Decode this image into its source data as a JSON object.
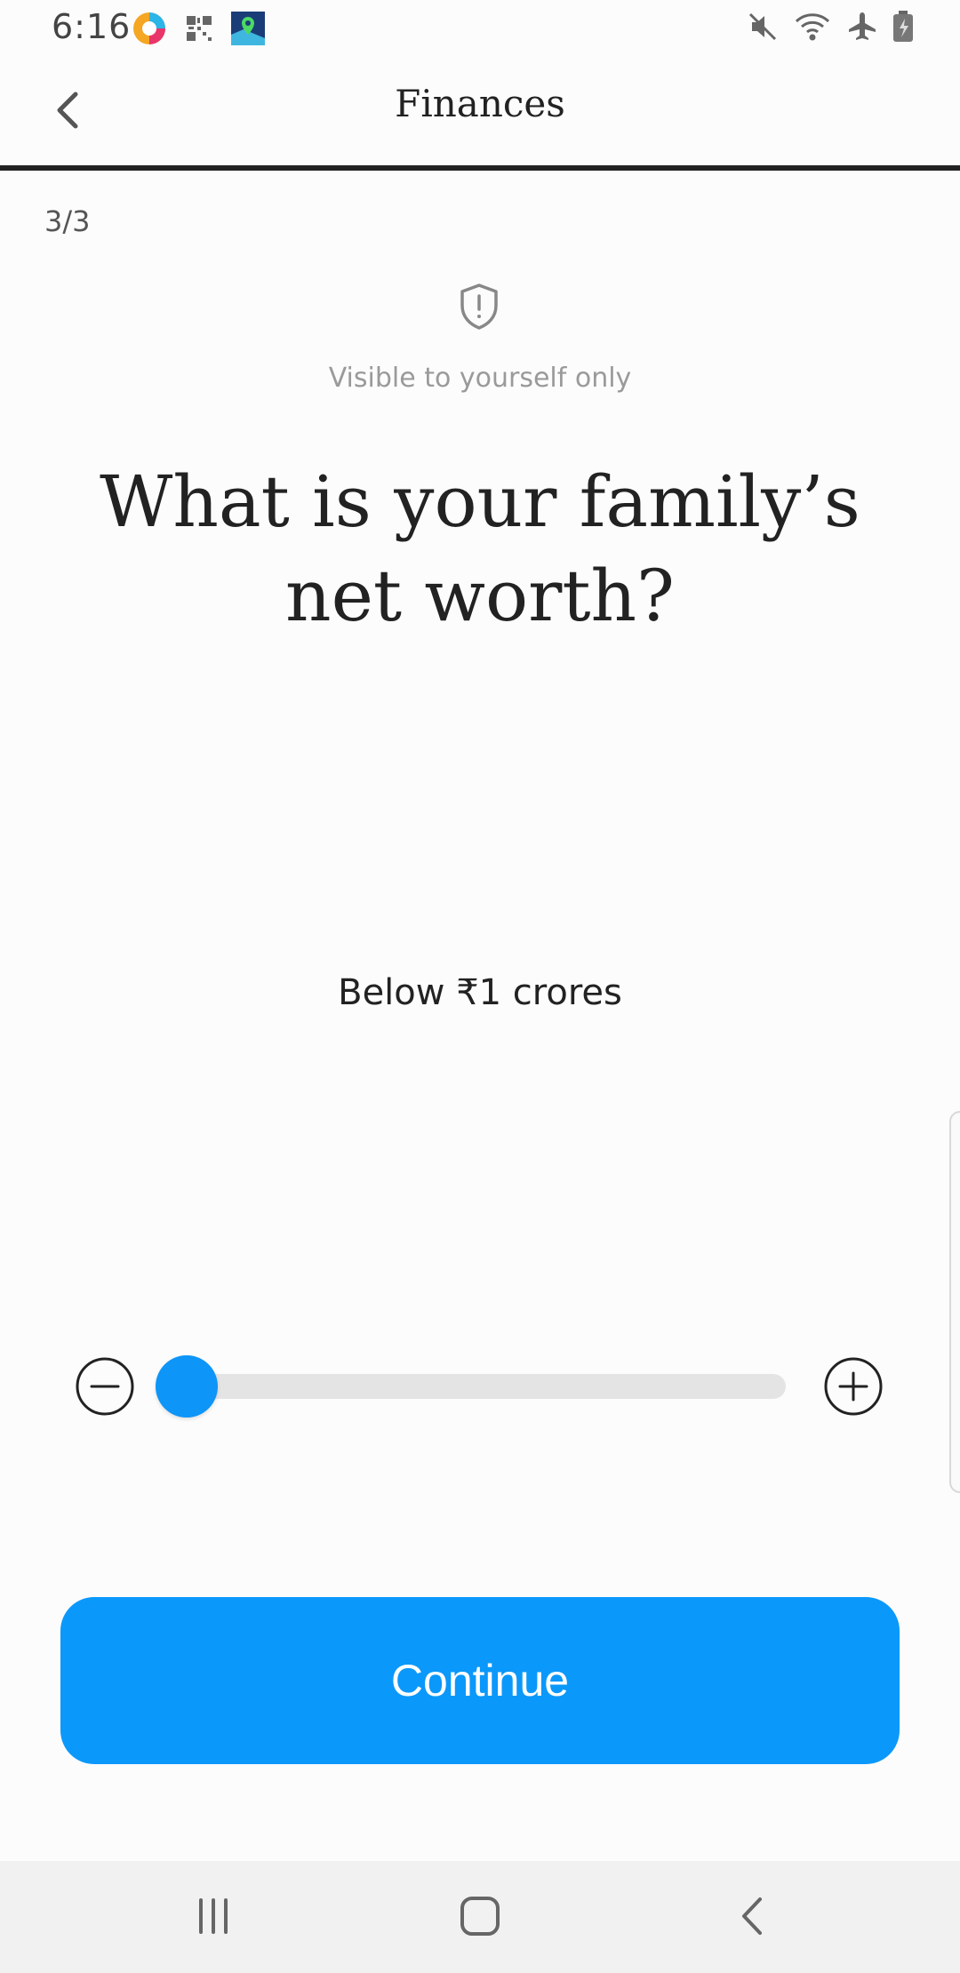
{
  "status_bar": {
    "time": "6:16",
    "left_icons": [
      "browser-app-icon",
      "qr-code-icon",
      "maps-app-icon"
    ],
    "right_icons": [
      "mute-icon",
      "wifi-icon",
      "airplane-mode-icon",
      "battery-charging-icon"
    ]
  },
  "app_bar": {
    "title": "Finances",
    "back_icon": "chevron-left-icon"
  },
  "step": "3/3",
  "privacy": {
    "icon": "shield-alert-icon",
    "text": "Visible to yourself only"
  },
  "question": "What is your family’s net worth?",
  "selection": {
    "value_label": "Below ₹1 crores",
    "slider_fraction": 0
  },
  "actions": {
    "continue_label": "Continue"
  },
  "colors": {
    "accent": "#0b98fb",
    "track": "#e4e4e4",
    "text": "#222222"
  },
  "nav_bar": {
    "icons": [
      "recents-icon",
      "home-icon",
      "back-icon"
    ]
  }
}
